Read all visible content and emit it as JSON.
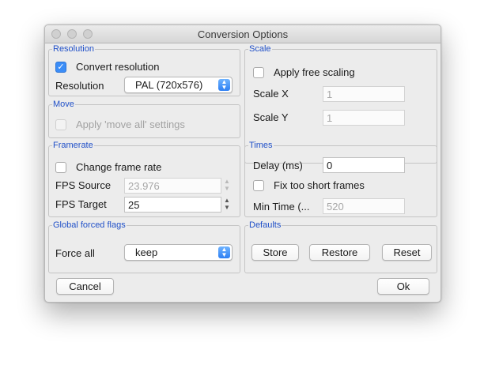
{
  "window": {
    "title": "Conversion Options"
  },
  "resolution": {
    "legend": "Resolution",
    "convert_label": "Convert resolution",
    "convert_checked": true,
    "resolution_label": "Resolution",
    "resolution_value": "PAL (720x576)"
  },
  "scale": {
    "legend": "Scale",
    "apply_label": "Apply free scaling",
    "scale_x_label": "Scale X",
    "scale_x_value": "1",
    "scale_y_label": "Scale Y",
    "scale_y_value": "1"
  },
  "move": {
    "legend": "Move",
    "apply_label": "Apply 'move all' settings"
  },
  "framerate": {
    "legend": "Framerate",
    "change_label": "Change frame rate",
    "fps_source_label": "FPS Source",
    "fps_source_value": "23.976",
    "fps_target_label": "FPS Target",
    "fps_target_value": "25"
  },
  "times": {
    "legend": "Times",
    "delay_label": "Delay (ms)",
    "delay_value": "0",
    "fix_label": "Fix too short frames",
    "min_time_label": "Min Time (...",
    "min_time_value": "520"
  },
  "global": {
    "legend": "Global forced flags",
    "force_all_label": "Force all",
    "force_all_value": "keep"
  },
  "defaults": {
    "legend": "Defaults",
    "store": "Store",
    "restore": "Restore",
    "reset": "Reset"
  },
  "footer": {
    "cancel": "Cancel",
    "ok": "Ok"
  },
  "icons": {
    "checkmark": "✓",
    "popup_arrows": "▲▼",
    "spinner_up": "▲",
    "spinner_down": "▼"
  },
  "colors": {
    "legend_blue": "#2050c8",
    "accent_blue": "#3b8df7"
  }
}
